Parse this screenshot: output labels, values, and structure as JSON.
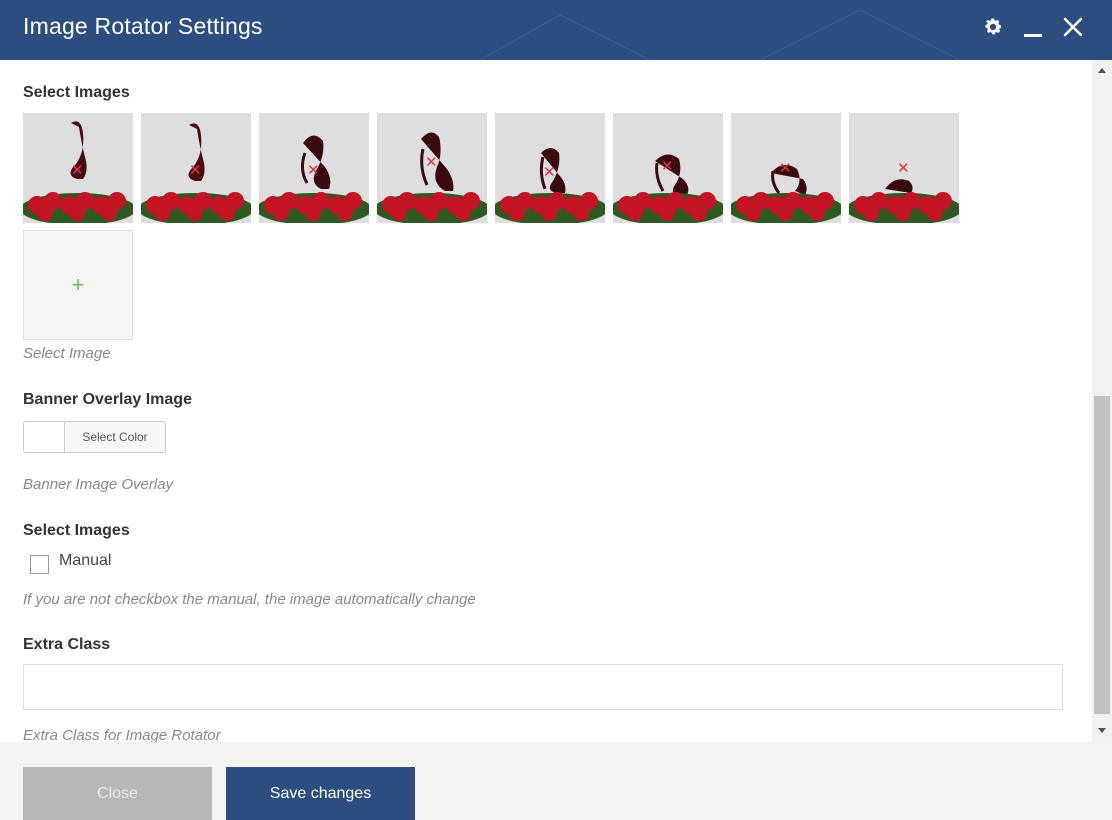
{
  "dialog": {
    "title": "Image Rotator Settings",
    "header_color": "#2c4d80"
  },
  "header_icons": [
    "gear-icon",
    "minimize-icon",
    "close-icon"
  ],
  "select_images": {
    "label": "Select Images",
    "thumbnails": [
      {
        "remove": "✕"
      },
      {
        "remove": "✕"
      },
      {
        "remove": "✕"
      },
      {
        "remove": "✕"
      },
      {
        "remove": "✕"
      },
      {
        "remove": "✕"
      },
      {
        "remove": "✕"
      },
      {
        "remove": "✕"
      }
    ],
    "add_symbol": "+",
    "hint": "Select Image"
  },
  "banner_overlay": {
    "label": "Banner Overlay Image",
    "button_label": "Select Color",
    "hint": "Banner Image Overlay"
  },
  "manual_section": {
    "label": "Select Images",
    "checkbox_label": "Manual",
    "checked": false,
    "hint": "If you are not checkbox the manual, the image automatically change"
  },
  "extra_class": {
    "label": "Extra Class",
    "value": "",
    "placeholder": "",
    "hint": "Extra Class for Image Rotator"
  },
  "footer": {
    "close_label": "Close",
    "save_label": "Save changes"
  }
}
